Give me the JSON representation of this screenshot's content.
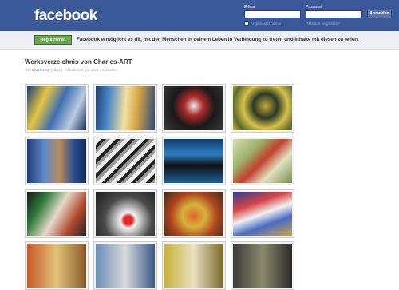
{
  "header": {
    "logo": "facebook",
    "email_label": "E-Mail",
    "password_label": "Passwort",
    "email_value": "",
    "password_value": "",
    "remember_label": "Angemeldet bleiben",
    "forgot_label": "Passwort vergessen?",
    "login_label": "Anmelden"
  },
  "signup": {
    "button_label": "Registrieren",
    "text": "Facebook ermöglicht es dir, mit den Menschen in deinem Leben in Verbindung zu treten und Inhalte mit diesen zu teilen."
  },
  "album": {
    "title": "Werksverzeichnis von Charles-ART",
    "meta_prefix": "Von ",
    "meta_link": "Charles Art",
    "meta_suffix": " (Alben) · Aktualisiert: vor etwa 4 Monaten"
  },
  "photos": [
    {
      "name": "photo-blue-yellow-abstract",
      "style": "a0"
    },
    {
      "name": "photo-blue-figure",
      "style": "a1"
    },
    {
      "name": "photo-dark-face",
      "style": "a2"
    },
    {
      "name": "photo-yellow-green-circle",
      "style": "a3"
    },
    {
      "name": "photo-blue-figures",
      "style": "a4"
    },
    {
      "name": "photo-black-white-abstract",
      "style": "a5"
    },
    {
      "name": "photo-blue-black-abstract",
      "style": "a6"
    },
    {
      "name": "photo-green-red-abstract",
      "style": "a7"
    },
    {
      "name": "photo-dark-green-abstract",
      "style": "a8"
    },
    {
      "name": "photo-clown-face",
      "style": "a9"
    },
    {
      "name": "photo-yellow-orange-figure",
      "style": "a10"
    },
    {
      "name": "photo-flag-abstract",
      "style": "a11"
    },
    {
      "name": "photo-orange-partial",
      "style": "a12"
    },
    {
      "name": "photo-blue-grey-partial",
      "style": "a13"
    },
    {
      "name": "photo-yellow-partial",
      "style": "a14"
    },
    {
      "name": "photo-dark-partial",
      "style": "a15"
    }
  ]
}
